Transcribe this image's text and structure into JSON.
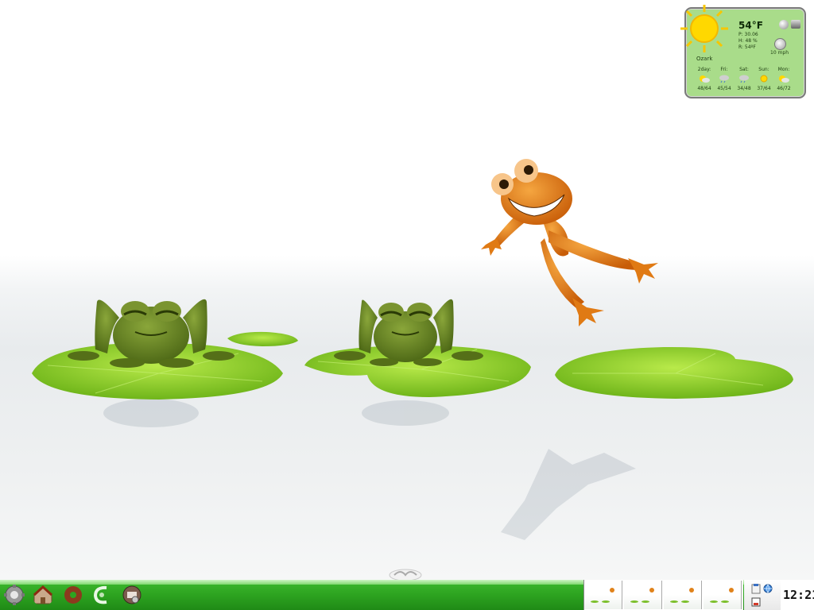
{
  "wallpaper": {
    "description_icon": "frogs-wallpaper"
  },
  "weather": {
    "temperature": "54°F",
    "pressure": "P: 30.06",
    "humidity": "H: 48 %",
    "real_feel": "R: 54ºF",
    "wind": "10 mph",
    "location": "Ozark",
    "forecast": [
      {
        "day": "2day:",
        "range": "48/64",
        "icon": "partly-sunny-icon"
      },
      {
        "day": "Fri:",
        "range": "45/54",
        "icon": "rain-cloud-icon"
      },
      {
        "day": "Sat:",
        "range": "34/48",
        "icon": "rain-cloud-icon"
      },
      {
        "day": "Sun:",
        "range": "37/64",
        "icon": "sun-icon"
      },
      {
        "day": "Mon:",
        "range": "46/72",
        "icon": "partly-sunny-icon"
      }
    ]
  },
  "taskbar": {
    "launchers": [
      "kmenu-gear-icon",
      "home-folder-icon",
      "donut-app-icon",
      "browser-icon",
      "system-settings-icon"
    ],
    "desktops": [
      "desktop-1",
      "desktop-2",
      "desktop-3",
      "desktop-4"
    ],
    "clock": "12:21"
  },
  "colors": {
    "taskbar": "#2da320",
    "widget_bg": "#a9dc8a",
    "lily_pad": "#8fd12a",
    "frog_green": "#5f7a1c",
    "frog_orange": "#e07a14"
  }
}
